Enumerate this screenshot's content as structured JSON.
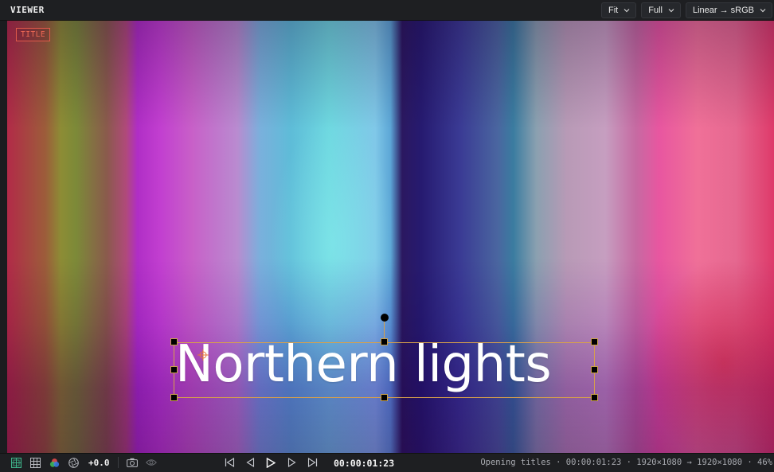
{
  "header": {
    "title": "VIEWER",
    "zoom": "Fit",
    "resolution": "Full",
    "color_transform": "Linear → sRGB"
  },
  "viewer": {
    "layer_tag": "TITLE",
    "title_text": "Northern lights"
  },
  "toolbar": {
    "exposure": "+0.0",
    "timecode": "00:00:01:23",
    "status": "Opening titles · 00:00:01:23 · 1920×1080 → 1920×1080 · 46%"
  },
  "colors": {
    "accent_selection": "#d8a04a",
    "title_tag": "#e25a4a",
    "active_tool": "#3fb38a"
  },
  "icons": [
    "safe-area-icon",
    "grid-icon",
    "color-channels-icon",
    "aperture-icon",
    "camera-icon",
    "eye-icon",
    "skip-start-icon",
    "step-back-icon",
    "play-icon",
    "step-forward-icon",
    "skip-end-icon"
  ]
}
